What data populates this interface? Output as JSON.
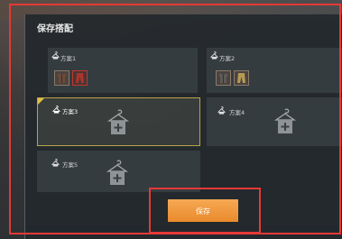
{
  "dialog": {
    "title": "保存搭配",
    "save_label": "保存"
  },
  "slots": [
    {
      "label": "方案1",
      "items": [
        "outfit-jacket",
        "outfit-pants"
      ]
    },
    {
      "label": "方案2",
      "items": [
        "outfit-jacket",
        "outfit-pants"
      ]
    },
    {
      "label": "方案3",
      "selected": true
    },
    {
      "label": "方案4"
    },
    {
      "label": "方案5"
    }
  ],
  "colors": {
    "accent": "#e98a2c",
    "highlight_frame": "#e53935",
    "selected_border": "#b9a24a"
  }
}
